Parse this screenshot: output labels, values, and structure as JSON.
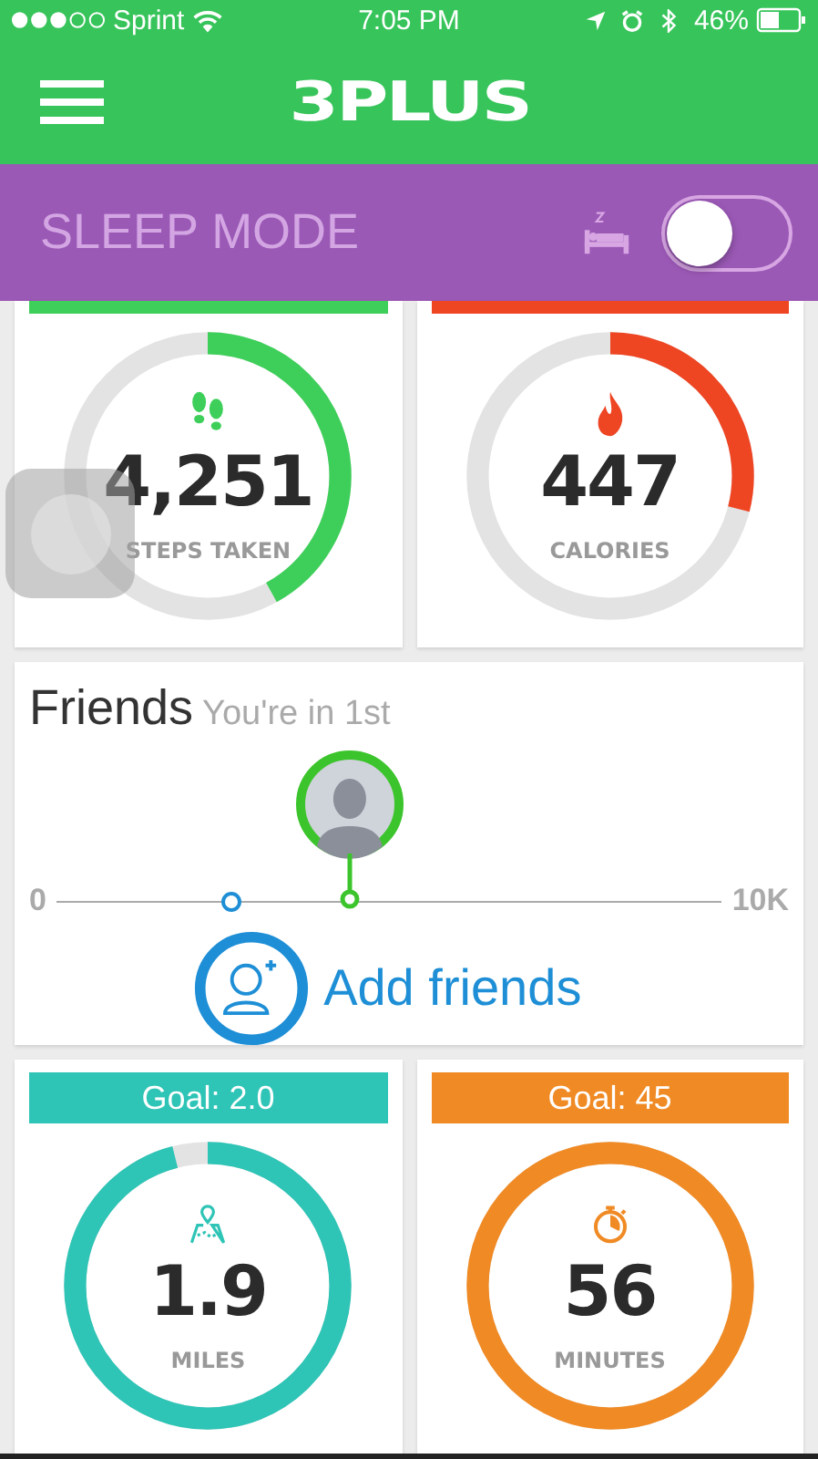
{
  "status_bar": {
    "carrier": "Sprint",
    "time": "7:05 PM",
    "battery": "46%"
  },
  "header": {
    "title": "3PLUS"
  },
  "sleep_mode": {
    "label": "SLEEP MODE",
    "on": false
  },
  "stats": [
    {
      "kind": "steps",
      "value": "4,251",
      "label": "STEPS TAKEN",
      "level": 0.42,
      "color": "#3ecf5a"
    },
    {
      "kind": "calories",
      "value": "447",
      "label": "CALORIES",
      "level": 0.29,
      "color": "#ee4523"
    },
    {
      "kind": "distance",
      "goal": "Goal: 2.0",
      "value": "1.9",
      "label": "MILES",
      "level": 0.96,
      "color": "#2ec4b6"
    },
    {
      "kind": "time",
      "goal": "Goal: 45",
      "value": "56",
      "label": "MINUTES",
      "level": 1,
      "color": "#f08a24"
    }
  ],
  "friends": {
    "title": "Friends",
    "subtitle": "You're in 1st",
    "scale_min": "0",
    "scale_max": "10K",
    "user_marker": {
      "level": 0.44
    },
    "add_marker": {
      "level": 0.26
    },
    "add_label": "Add friends"
  }
}
